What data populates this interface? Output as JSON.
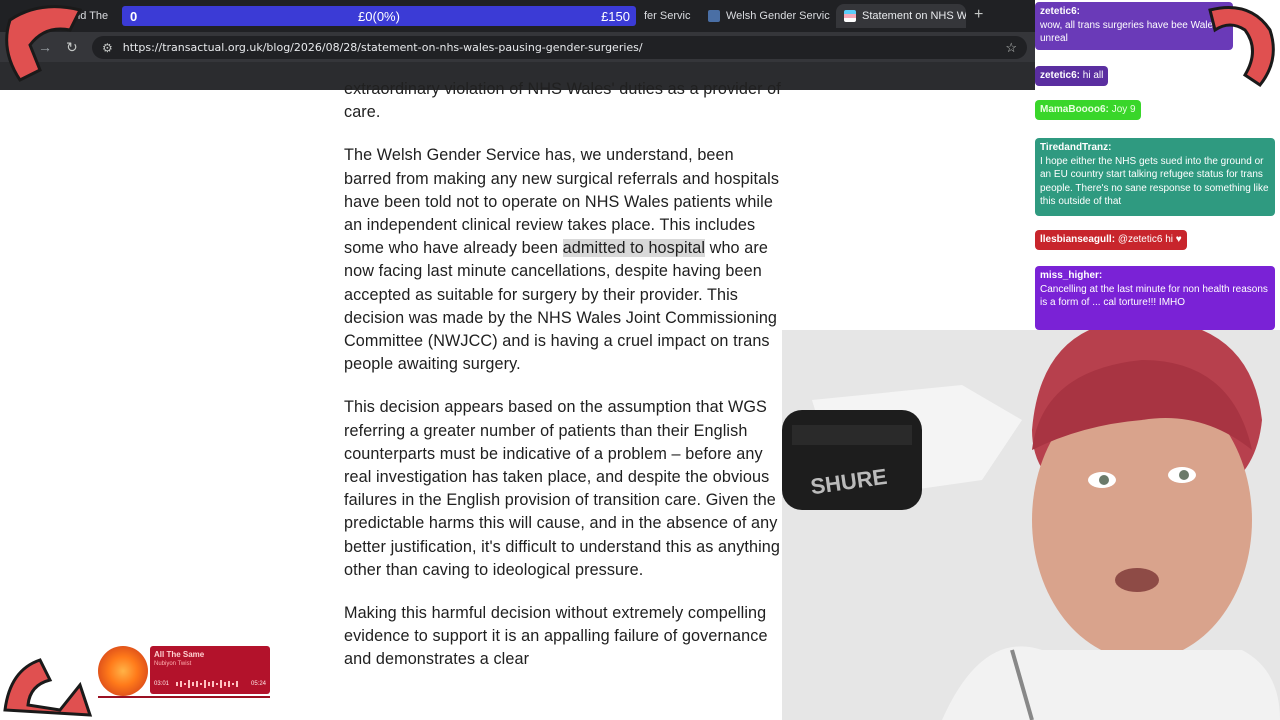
{
  "browser": {
    "tabs": [
      {
        "label": "and The",
        "active": false
      },
      {
        "label": "fer Servic",
        "active": false
      },
      {
        "label": "Welsh Gender Servic",
        "active": false
      },
      {
        "label": "Statement on NHS W",
        "active": true
      }
    ],
    "url": "https://transactual.org.uk/blog/2026/08/28/statement-on-nhs-wales-pausing-gender-surgeries/"
  },
  "donation": {
    "current": "0",
    "progress": "£0(0%)",
    "goal": "£150",
    "fraction": 0
  },
  "article": {
    "p0": "extraordinary violation of NHS Wales' duties as a provider of care.",
    "p1_before": "The Welsh Gender Service has, we understand, been barred from making any new surgical referrals and hospitals have been told not to operate on NHS Wales patients while an independent clinical review takes place. This includes some who have already been ",
    "p1_highlight": "admitted to hospital",
    "p1_after": " who are now facing last minute cancellations, despite having been accepted as suitable for surgery by their provider. This decision was made by the NHS Wales Joint Commissioning Committee (NWJCC) and is having a cruel impact on trans people awaiting surgery.",
    "p2": "This decision appears based on the assumption that WGS referring a greater number of patients than their English counterparts must be indicative of a problem – before any real investigation has taken place, and despite the obvious failures in the English provision of transition care. Given the predictable harms this will cause, and in the absence of any better justification, it's difficult to understand this as anything other than caving to ideological pressure.",
    "p3": "Making this harmful decision without extremely compelling evidence to support it is an appalling failure of governance and demonstrates a clear"
  },
  "chat": [
    {
      "user": "zetetic6:",
      "text": "wow, all trans surgeries have bee Wales? unreal"
    },
    {
      "user": "zetetic6:",
      "text": "hi all"
    },
    {
      "user": "MamaBoooo6:",
      "text": "Joy 9"
    },
    {
      "user": "TiredandTranz:",
      "text": "I hope either the NHS gets sued into the ground or an EU country start talking refugee status for trans people. There's no sane response to something like this outside of that"
    },
    {
      "user": "llesbianseagull:",
      "text": "@zetetic6 hi ♥"
    },
    {
      "user": "miss_higher:",
      "text": "Cancelling at the last minute for non health reasons is a form of ... cal torture!!! IMHO"
    }
  ],
  "player": {
    "title": "All The Same",
    "artist": "Nubiyon Twist",
    "elapsed": "03:01",
    "total": "05:24"
  },
  "colors": {
    "donation_bar": "#3b3bd6",
    "chat_purple": "#7a22d6",
    "chat_green": "#39d62a",
    "chat_teal": "#2f9a80",
    "chat_red": "#c8252c",
    "player_red": "#b3122b"
  }
}
